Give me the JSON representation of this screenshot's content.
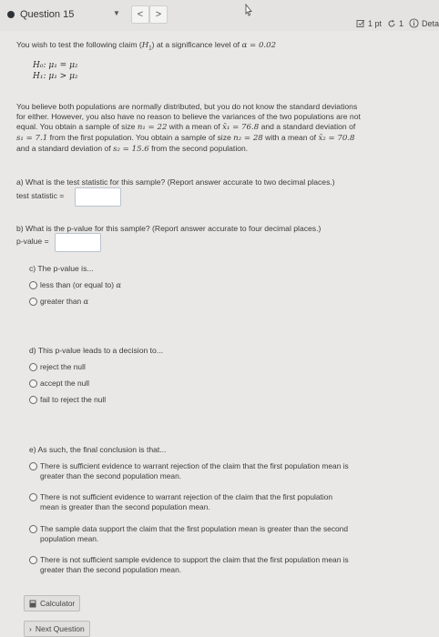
{
  "header": {
    "question_select": "Question 15",
    "prev_label": "<",
    "next_label": ">",
    "points": "1 pt",
    "retries": "1",
    "details": "Deta"
  },
  "intro": {
    "claim_prefix": "You wish to test the following claim (",
    "claim_h1": "H",
    "claim_sub": "1",
    "claim_mid": ") at a significance level of ",
    "alpha_sym": "α",
    "alpha_eq": " = 0.02",
    "h0_line": "H₀: μ₁ = μ₂",
    "h1_line": "H₁: μ₁ > μ₂"
  },
  "paragraph": {
    "line1": "You believe both populations are normally distributed, but you do not know the standard deviations",
    "line2": "for either. However, you also have no reason to believe the variances of the two populations are not",
    "line3a": "equal. You obtain a sample of size ",
    "n1": "n₁ = 22",
    "line3b": " with a mean of ",
    "x1": "x̄₁ = 76.8",
    "line3c": " and a standard deviation of",
    "s1": "s₁ = 7.1",
    "line4a": " from the first population. You obtain a sample of size ",
    "n2": "n₂ = 28",
    "line4b": " with a mean of ",
    "x2": "x̄₂ = 70.8",
    "line5a": "and a standard deviation of ",
    "s2": "s₂ = 15.6",
    "line5b": " from the second population."
  },
  "part_a": {
    "question": "a) What is the test statistic for this sample? (Report answer accurate to two decimal places.)",
    "label": "test statistic =",
    "value": ""
  },
  "part_b": {
    "question": "b) What is the p-value for this sample? (Report answer accurate to four decimal places.)",
    "label": "p-value =",
    "value": ""
  },
  "part_c": {
    "question": "c) The p-value is...",
    "options": [
      "less than (or equal to) ",
      "greater than "
    ],
    "alpha": "α"
  },
  "part_d": {
    "question": "d) This p-value leads to a decision to...",
    "options": [
      "reject the null",
      "accept the null",
      "fail to reject the null"
    ]
  },
  "part_e": {
    "question": "e) As such, the final conclusion is that...",
    "options": [
      [
        "There is sufficient evidence to warrant rejection of the claim that the first population mean is",
        "greater than the second population mean."
      ],
      [
        "There is not sufficient evidence to warrant rejection of the claim that the first population",
        "mean is greater than the second population mean."
      ],
      [
        "The sample data support the claim that the first population mean is greater than the second",
        "population mean."
      ],
      [
        "There is not sufficient sample evidence to support the claim that the first population mean is",
        "greater than the second population mean."
      ]
    ]
  },
  "footer": {
    "calculator": "Calculator",
    "next_question": "Next Question"
  }
}
